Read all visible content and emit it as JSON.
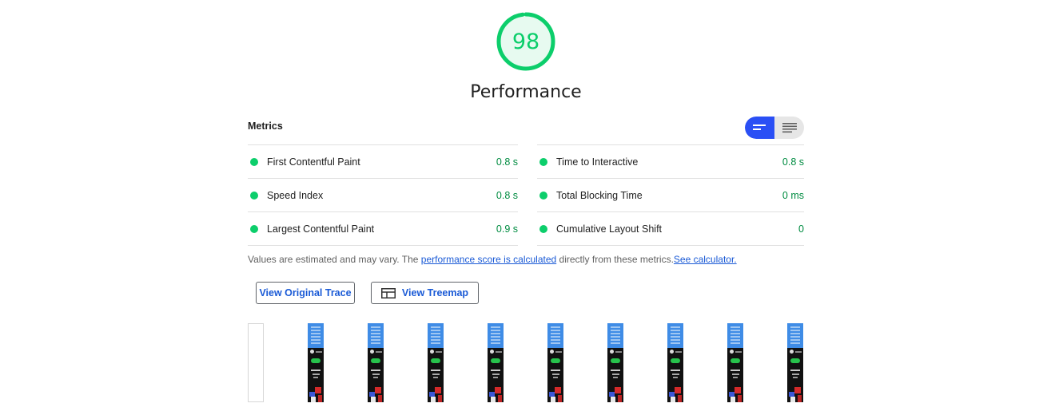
{
  "gauge": {
    "score": "98",
    "fraction": 0.98,
    "label": "Performance",
    "color": "#0cce6b"
  },
  "metrics": {
    "title": "Metrics",
    "toggle": {
      "active": "compact-view",
      "options": [
        "compact-view",
        "expanded-view"
      ]
    },
    "left": [
      {
        "name": "First Contentful Paint",
        "value": "0.8 s"
      },
      {
        "name": "Speed Index",
        "value": "0.8 s"
      },
      {
        "name": "Largest Contentful Paint",
        "value": "0.9 s"
      }
    ],
    "right": [
      {
        "name": "Time to Interactive",
        "value": "0.8 s"
      },
      {
        "name": "Total Blocking Time",
        "value": "0 ms"
      },
      {
        "name": "Cumulative Layout Shift",
        "value": "0"
      }
    ],
    "pass_color": "#0cce6b",
    "value_color": "#008c41"
  },
  "note": {
    "prefix": "Values are estimated and may vary. The ",
    "link1": "performance score is calculated",
    "middle": " directly from these metrics.",
    "link2": "See calculator."
  },
  "buttons": {
    "trace": "View Original Trace",
    "treemap": "View Treemap"
  },
  "filmstrip": {
    "frame_count": 9
  }
}
